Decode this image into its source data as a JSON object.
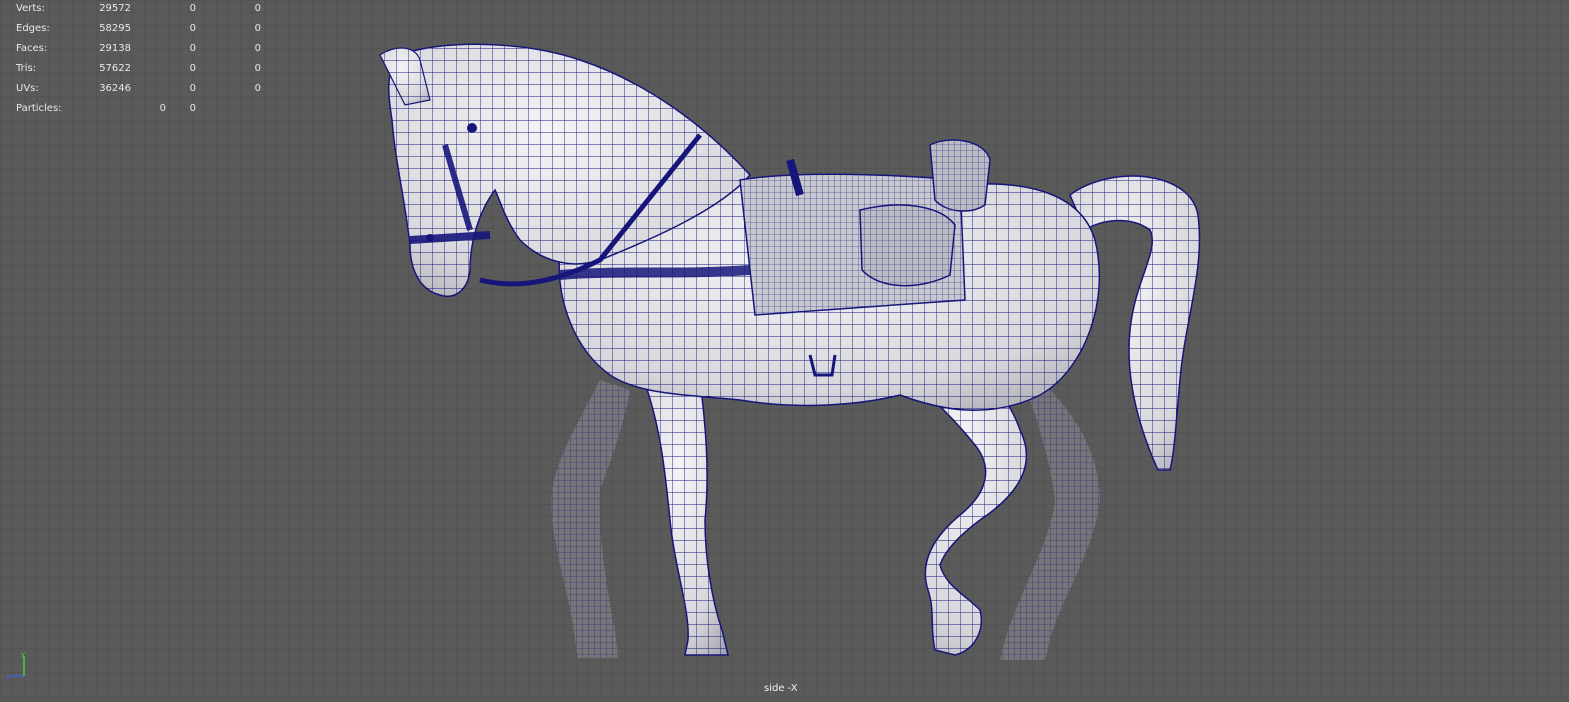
{
  "heads_up_display": {
    "poly_count": [
      {
        "label": "Verts:",
        "v1": "29572",
        "v2": "0",
        "v3": "0"
      },
      {
        "label": "Edges:",
        "v1": "58295",
        "v2": "0",
        "v3": "0"
      },
      {
        "label": "Faces:",
        "v1": "29138",
        "v2": "0",
        "v3": "0"
      },
      {
        "label": "Tris:",
        "v1": "57622",
        "v2": "0",
        "v3": "0"
      },
      {
        "label": "UVs:",
        "v1": "36246",
        "v2": "0",
        "v3": "0"
      }
    ],
    "particles": {
      "label": "Particles:",
      "v1": "0",
      "v2": "0"
    }
  },
  "viewport": {
    "camera_label": "side -X",
    "axis_colors": {
      "y": "#3fd23f",
      "x": "#d24040",
      "z": "#4060e0"
    },
    "wire_color": "#16167a",
    "mesh_color": "#e6e6ea"
  }
}
